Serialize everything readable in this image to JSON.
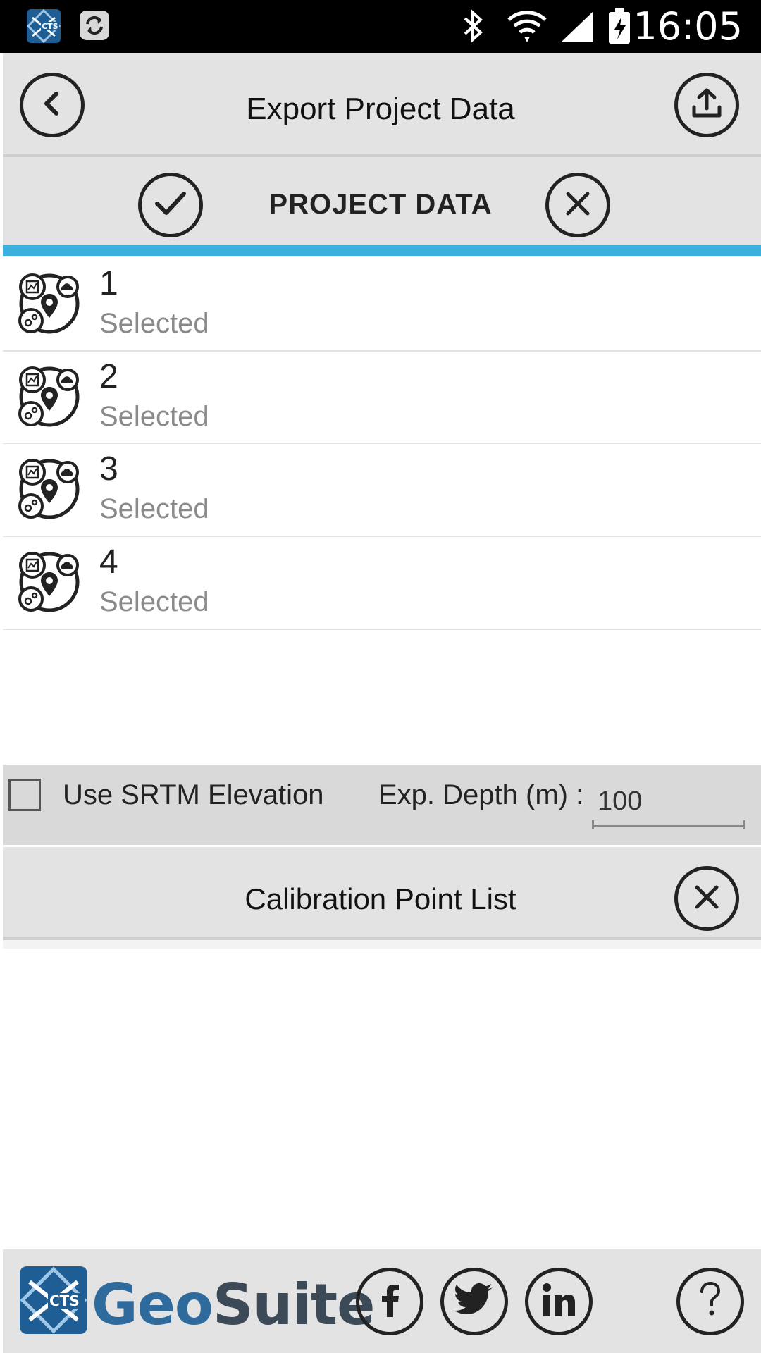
{
  "status_bar": {
    "time": "16:05",
    "icons": [
      "cts-app-icon",
      "sync-icon",
      "bluetooth-icon",
      "wifi-icon",
      "signal-icon",
      "battery-charging-icon"
    ]
  },
  "header": {
    "title": "Export Project Data",
    "back_icon": "back-chevron-icon",
    "upload_icon": "upload-icon"
  },
  "subheader": {
    "title": "PROJECT DATA",
    "select_all_icon": "check-icon",
    "deselect_icon": "close-icon"
  },
  "accent_color": "#3bb0e0",
  "projects": [
    {
      "name": "1",
      "status": "Selected"
    },
    {
      "name": "2",
      "status": "Selected"
    },
    {
      "name": "3",
      "status": "Selected"
    },
    {
      "name": "4",
      "status": "Selected"
    }
  ],
  "options": {
    "srtm_label": "Use SRTM Elevation",
    "srtm_checked": false,
    "depth_label": "Exp. Depth (m) :",
    "depth_value": "100"
  },
  "calibration": {
    "title": "Calibration Point List",
    "close_icon": "close-icon"
  },
  "footer": {
    "brand_geo": "Geo",
    "brand_suite": "Suite",
    "social_icons": [
      "facebook-icon",
      "twitter-icon",
      "linkedin-icon"
    ],
    "help_icon": "help-icon"
  }
}
